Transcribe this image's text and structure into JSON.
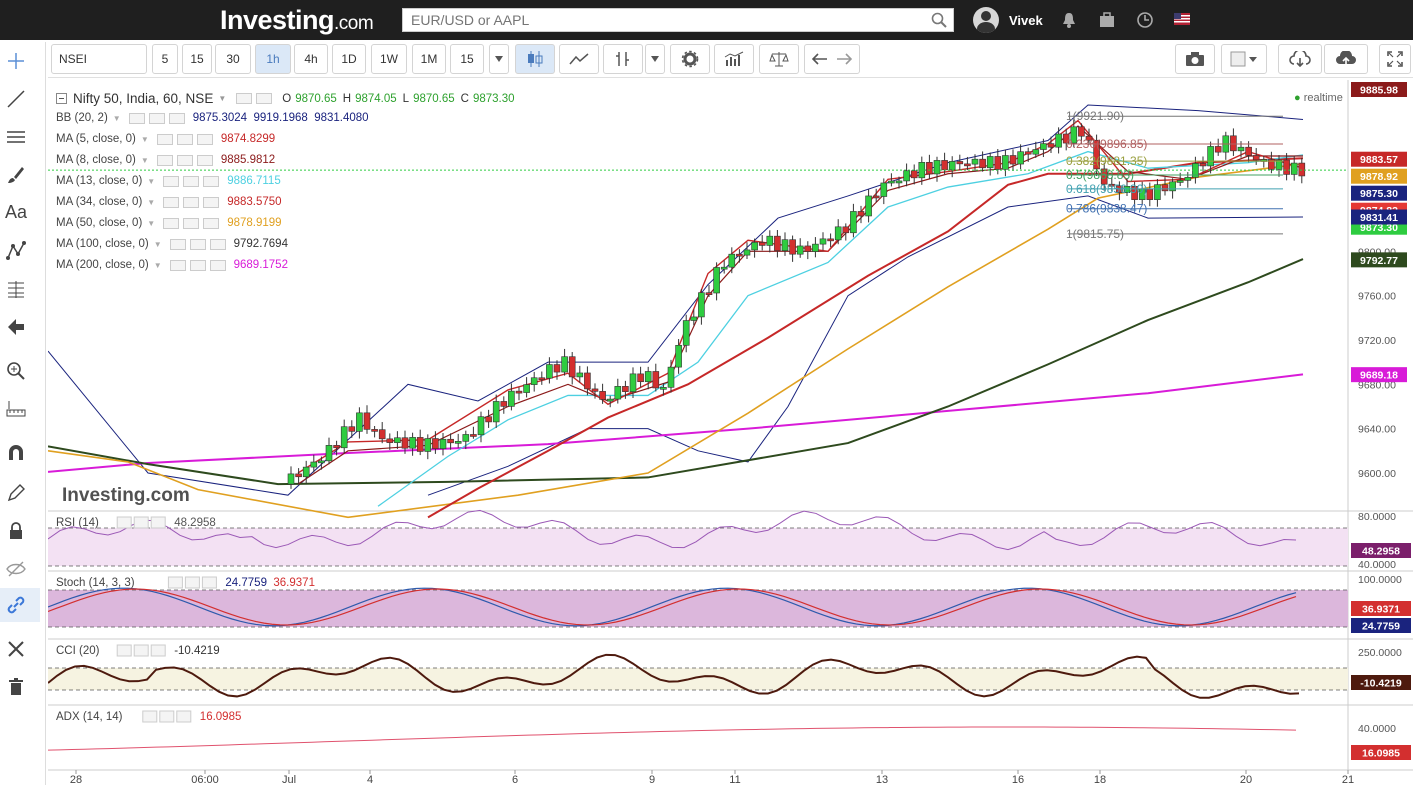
{
  "header": {
    "logo_main": "Investing",
    "logo_dot": ".com",
    "search_placeholder": "EUR/USD or AAPL",
    "user_name": "Vivek"
  },
  "toolbar": {
    "symbol": "NSEI",
    "intervals": [
      "5",
      "15",
      "30",
      "1h",
      "4h",
      "1D",
      "1W",
      "1M",
      "15"
    ],
    "active_interval": "1h"
  },
  "main_legend": {
    "title": "Nifty 50, India, 60, NSE",
    "o_label": "O",
    "o": "9870.65",
    "h_label": "H",
    "h": "9874.05",
    "l_label": "L",
    "l": "9870.65",
    "c_label": "C",
    "c": "9873.30",
    "realtime": "realtime"
  },
  "indicators": [
    {
      "name": "BB (20, 2)",
      "values": "9875.3024  9919.1968  9831.4080",
      "color": "#1a237e"
    },
    {
      "name": "MA (5, close, 0)",
      "values": "9874.8299",
      "color": "#c62828"
    },
    {
      "name": "MA (8, close, 0)",
      "values": "9885.9812",
      "color": "#8b1a1a"
    },
    {
      "name": "MA (13, close, 0)",
      "values": "9886.7115",
      "color": "#4dd0e1"
    },
    {
      "name": "MA (34, close, 0)",
      "values": "9883.5750",
      "color": "#c62828"
    },
    {
      "name": "MA (50, close, 0)",
      "values": "9878.9199",
      "color": "#e0a020"
    },
    {
      "name": "MA (100, close, 0)",
      "values": "9792.7694",
      "color": "#333333"
    },
    {
      "name": "MA (200, close, 0)",
      "values": "9689.1752",
      "color": "#d81bd8"
    }
  ],
  "price_axis": {
    "ticks": [
      "9840.00",
      "9800.00",
      "9760.00",
      "9720.00",
      "9680.00",
      "9640.00",
      "9600.00"
    ],
    "badges": [
      {
        "text": "9885.98",
        "bg": "#8b1a1a"
      },
      {
        "text": "9883.57",
        "bg": "#c62828"
      },
      {
        "text": "9878.92",
        "bg": "#e0a020"
      },
      {
        "text": "9875.30",
        "bg": "#1a237e"
      },
      {
        "text": "9874.83",
        "bg": "#e53935"
      },
      {
        "text": "9873.30",
        "bg": "#2ecc40"
      },
      {
        "text": "9831.41",
        "bg": "#1a237e"
      },
      {
        "text": "9792.77",
        "bg": "#2e4a1e"
      },
      {
        "text": "9689.18",
        "bg": "#d81bd8"
      }
    ]
  },
  "fib_labels": [
    "1(9921.90)",
    "0.236(9896.85)",
    "0.382(9881.35)",
    "0.5(9868.83)",
    "0.618(9856.30)",
    "0.786(9838.47)",
    "1(9815.75)"
  ],
  "watermark": "Investing.com",
  "rsi": {
    "name": "RSI (14)",
    "value": "48.2958",
    "ticks": [
      "80.0000",
      "40.0000"
    ],
    "badge": "48.2958"
  },
  "stoch": {
    "name": "Stoch (14, 3, 3)",
    "k": "24.7759",
    "d": "36.9371",
    "ticks": [
      "100.0000"
    ],
    "badge_d": "36.9371",
    "badge_k": "24.7759"
  },
  "cci": {
    "name": "CCI (20)",
    "value": "-10.4219",
    "ticks": [
      "250.0000"
    ],
    "badge": "-10.4219"
  },
  "adx": {
    "name": "ADX (14, 14)",
    "value": "16.0985",
    "ticks": [
      "40.0000"
    ],
    "badge": "16.0985"
  },
  "time_axis": [
    "28",
    "06:00",
    "Jul",
    "4",
    "6",
    "9",
    "11",
    "13",
    "16",
    "18",
    "20",
    "21"
  ]
}
